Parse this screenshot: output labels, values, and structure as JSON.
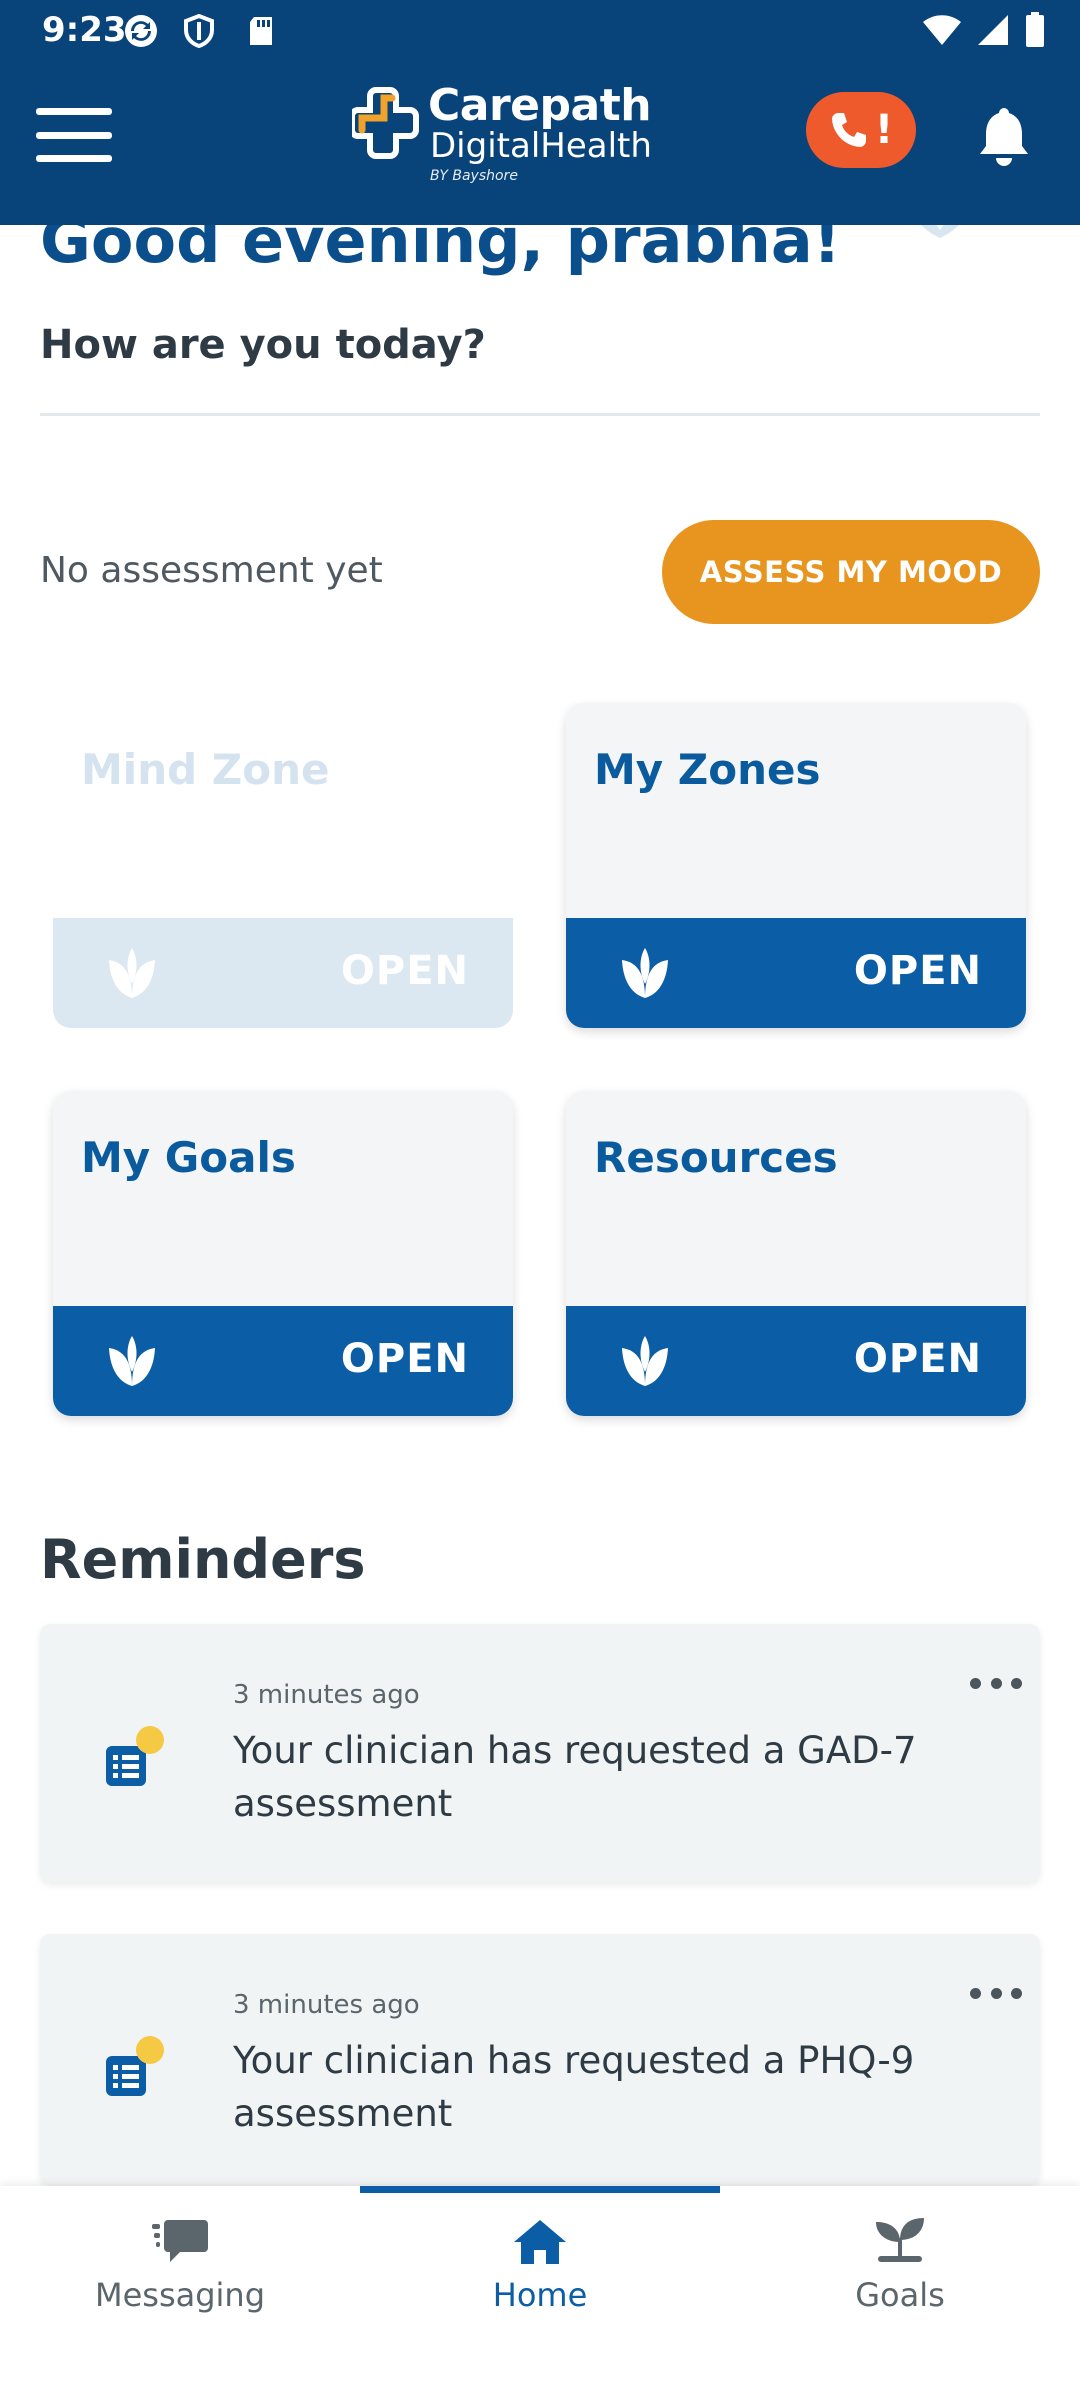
{
  "status_bar": {
    "time": "9:23",
    "icons": [
      "sync-icon",
      "shield-icon",
      "sd-card-icon",
      "wifi-icon",
      "signal-icon",
      "battery-icon"
    ]
  },
  "header": {
    "brand": "Carepath",
    "brand_sub": "DigitalHealth",
    "brand_byline": "BY Bayshore",
    "emergency_mark": "!",
    "icons": {
      "menu": "hamburger-menu-icon",
      "emergency": "phone-alert-icon",
      "notifications": "bell-icon"
    },
    "colors": {
      "bar": "#08437a",
      "emergency": "#ef5a2c"
    }
  },
  "greeting": {
    "title": "Good evening, prabha!",
    "subtitle": "How are you today?"
  },
  "assessment": {
    "status": "No assessment yet",
    "button_label": "ASSESS MY MOOD",
    "button_color": "#e8951f"
  },
  "tiles": [
    {
      "title": "Mind Zone",
      "action": "OPEN",
      "enabled": false
    },
    {
      "title": "My Zones",
      "action": "OPEN",
      "enabled": true
    },
    {
      "title": "My Goals",
      "action": "OPEN",
      "enabled": true
    },
    {
      "title": "Resources",
      "action": "OPEN",
      "enabled": true
    }
  ],
  "reminders": {
    "title": "Reminders",
    "items": [
      {
        "time": "3 minutes ago",
        "text": "Your clinician has requested a GAD-7 assessment",
        "icon": "assessment-list-icon"
      },
      {
        "time": "3 minutes ago",
        "text": "Your clinician has requested a PHQ-9 assessment",
        "icon": "assessment-list-icon"
      }
    ]
  },
  "bottom_nav": {
    "items": [
      {
        "label": "Messaging",
        "icon": "chat-icon",
        "active": false
      },
      {
        "label": "Home",
        "icon": "home-icon",
        "active": true
      },
      {
        "label": "Goals",
        "icon": "sprout-icon",
        "active": false
      }
    ],
    "active_color": "#0b5ea5"
  }
}
